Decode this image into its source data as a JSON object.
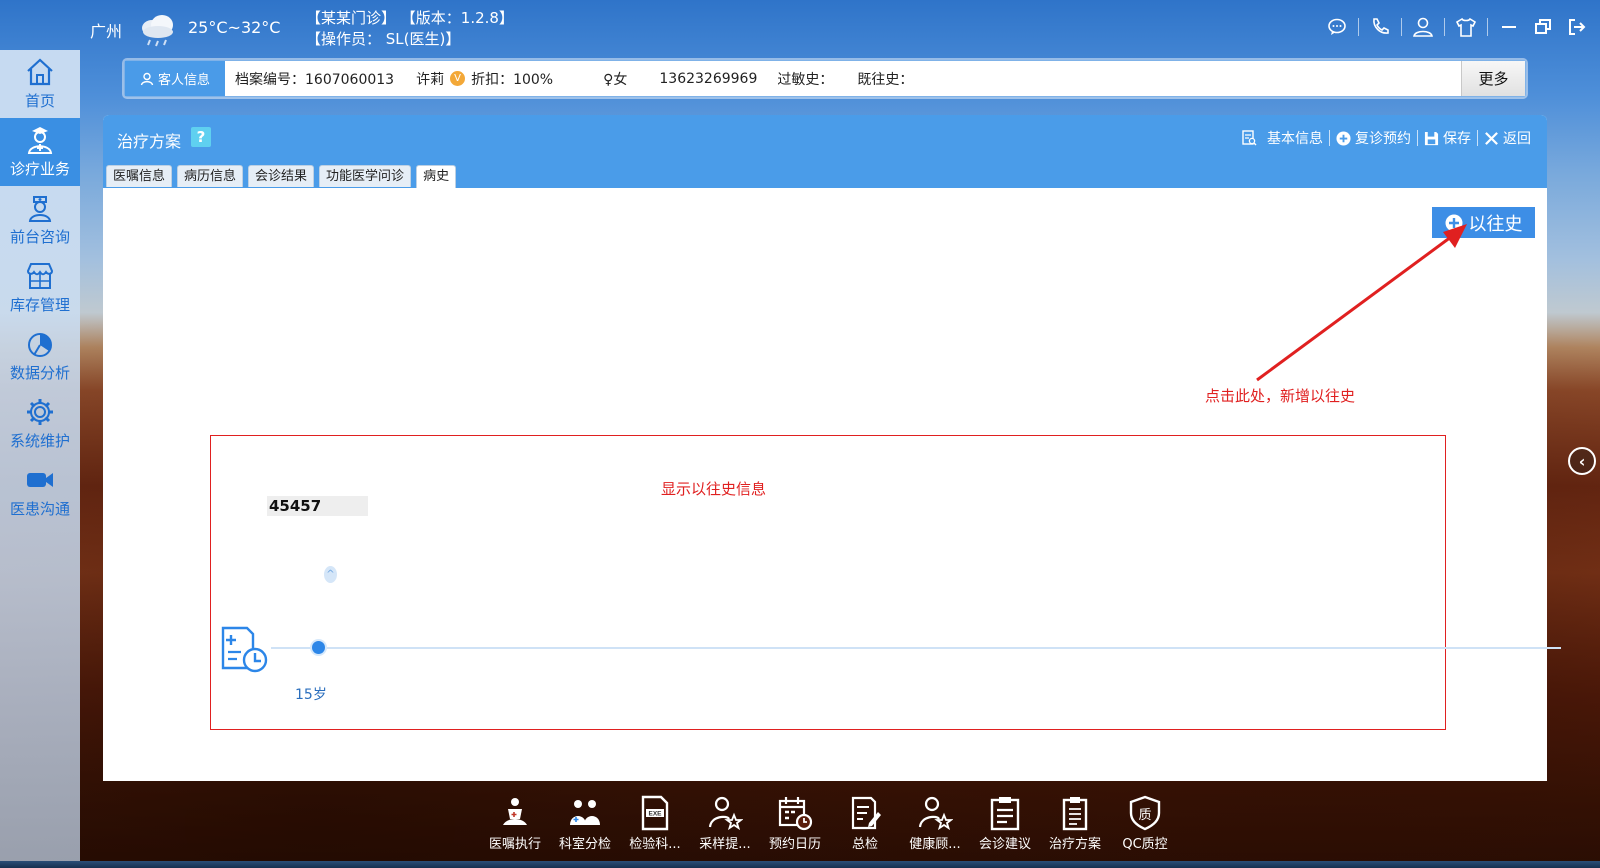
{
  "topbar": {
    "city": "广州",
    "temperature": "25°C~32°C",
    "clinic_line": "【某某门诊】   【版本：1.2.8】",
    "operator_line": "【操作员： SL(医生)】"
  },
  "nav": {
    "items": [
      {
        "label": "首页",
        "icon": "home-icon"
      },
      {
        "label": "诊疗业务",
        "icon": "doctor-icon"
      },
      {
        "label": "前台咨询",
        "icon": "nurse-icon"
      },
      {
        "label": "库存管理",
        "icon": "store-icon"
      },
      {
        "label": "数据分析",
        "icon": "pie-chart-icon"
      },
      {
        "label": "系统维护",
        "icon": "gear-icon"
      },
      {
        "label": "医患沟通",
        "icon": "video-icon"
      }
    ]
  },
  "patient": {
    "tab_label": "客人信息",
    "file_no": "档案编号：1607060013",
    "name": "许莉",
    "vip": "V",
    "discount": "折扣：100%",
    "gender": "♀女",
    "phone": "13623269969",
    "allergy": "过敏史：",
    "past_history": "既往史：",
    "more_label": "更多"
  },
  "panel": {
    "title": "治疗方案",
    "help": "?",
    "actions": {
      "basic_info": "基本信息",
      "revisit": "复诊预约",
      "save": "保存",
      "back": "返回"
    },
    "tabs": [
      "医嘱信息",
      "病历信息",
      "会诊结果",
      "功能医学问诊",
      "病史"
    ],
    "active_tab": 4,
    "add_history_label": "以往史",
    "annotation_click": "点击此处，新增以往史",
    "annotation_show": "显示以往史信息",
    "record_value": "45457",
    "age_label": "15岁"
  },
  "dock": [
    {
      "label": "医嘱执行",
      "icon": "order-exec-icon"
    },
    {
      "label": "科室分检",
      "icon": "department-icon"
    },
    {
      "label": "检验科...",
      "icon": "exe-file-icon"
    },
    {
      "label": "采样提...",
      "icon": "user-star-icon"
    },
    {
      "label": "预约日历",
      "icon": "calendar-clock-icon"
    },
    {
      "label": "总检",
      "icon": "document-edit-icon"
    },
    {
      "label": "健康顾...",
      "icon": "user-star-icon"
    },
    {
      "label": "会诊建议",
      "icon": "clipboard-icon"
    },
    {
      "label": "治疗方案",
      "icon": "clipboard-list-icon"
    },
    {
      "label": "QC质控",
      "icon": "shield-quality-icon"
    }
  ],
  "colors": {
    "primary": "#4a9ce9",
    "annotation": "#e02020",
    "timeline_node": "#2c86e8"
  }
}
